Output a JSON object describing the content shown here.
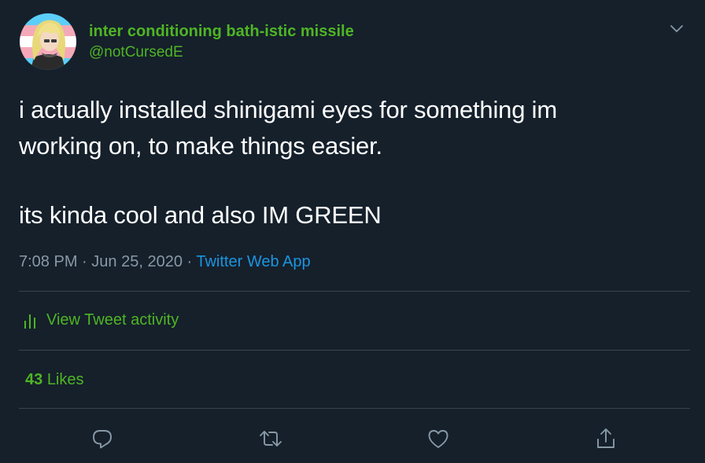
{
  "tweet": {
    "display_name": "inter conditioning bath-istic missile",
    "handle": "@notCursedE",
    "text_lines": [
      "i actually installed shinigami eyes for something im",
      "working on, to make things easier.",
      "its kinda cool and also IM GREEN"
    ],
    "time": "7:08 PM",
    "date": "Jun 25, 2020",
    "separator": "·",
    "source": "Twitter Web App",
    "activity_label": "View Tweet activity",
    "likes_count": "43",
    "likes_label": "Likes"
  },
  "colors": {
    "background": "#15202b",
    "accent_green": "#4fb524",
    "link_blue": "#1b95e0",
    "muted": "#8899a6",
    "divider": "#38444d"
  },
  "icons": {
    "menu": "chevron-down-icon",
    "activity": "bar-chart-icon",
    "reply": "reply-icon",
    "retweet": "retweet-icon",
    "like": "heart-icon",
    "share": "share-icon"
  }
}
